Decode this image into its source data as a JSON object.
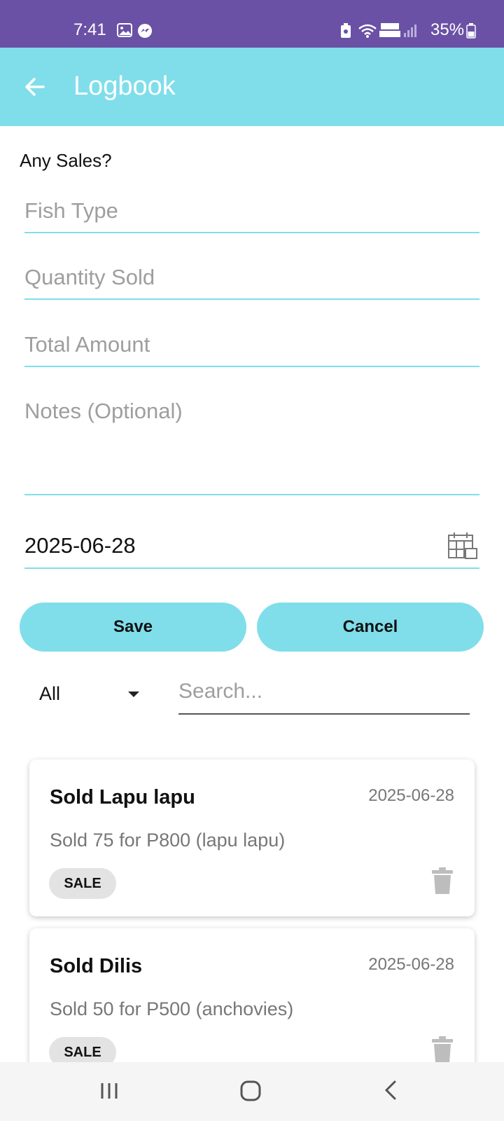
{
  "status_bar": {
    "time": "7:41",
    "battery": "35%"
  },
  "app_bar": {
    "title": "Logbook"
  },
  "form": {
    "section_label": "Any Sales?",
    "fish_type_placeholder": "Fish Type",
    "quantity_placeholder": "Quantity Sold",
    "amount_placeholder": "Total Amount",
    "notes_placeholder": "Notes (Optional)",
    "date_value": "2025-06-28",
    "save_label": "Save",
    "cancel_label": "Cancel"
  },
  "filter": {
    "selected": "All",
    "search_placeholder": "Search..."
  },
  "entries": [
    {
      "title": "Sold Lapu lapu",
      "date": "2025-06-28",
      "description": "Sold 75 for P800 (lapu lapu)",
      "badge": "SALE"
    },
    {
      "title": "Sold Dilis",
      "date": "2025-06-28",
      "description": "Sold 50 for P500 (anchovies)",
      "badge": "SALE"
    }
  ],
  "colors": {
    "status_bar": "#6a51a5",
    "accent": "#80deea"
  }
}
